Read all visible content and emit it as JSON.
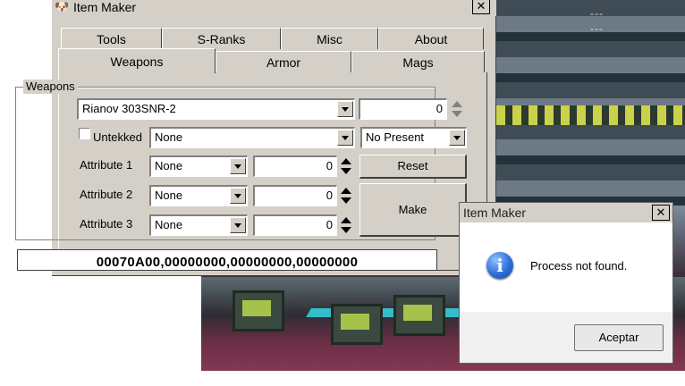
{
  "window": {
    "title": "Item Maker",
    "close_label": "✕"
  },
  "tabs_row1": [
    "Tools",
    "S-Ranks",
    "Misc",
    "About"
  ],
  "tabs_row2": [
    "Weapons",
    "Armor",
    "Mags"
  ],
  "active_tab": "Weapons",
  "weapons": {
    "group_label": "Weapons",
    "item_select": "Rianov 303SNR-2",
    "item_value": "0",
    "untekked_label": "Untekked",
    "special_select": "None",
    "present_select": "No Present",
    "attributes": [
      {
        "label": "Attribute 1",
        "type": "None",
        "value": "0"
      },
      {
        "label": "Attribute 2",
        "type": "None",
        "value": "0"
      },
      {
        "label": "Attribute 3",
        "type": "None",
        "value": "0"
      }
    ],
    "reset_label": "Reset",
    "make_label": "Make",
    "hex_code": "00070A00,00000000,00000000,00000000"
  },
  "dialog": {
    "title": "Item Maker",
    "close_label": "✕",
    "message": "Process not found.",
    "button_label": "Aceptar",
    "icon": "info-icon"
  },
  "hud": {
    "dash1": "---",
    "dash2": "---"
  }
}
